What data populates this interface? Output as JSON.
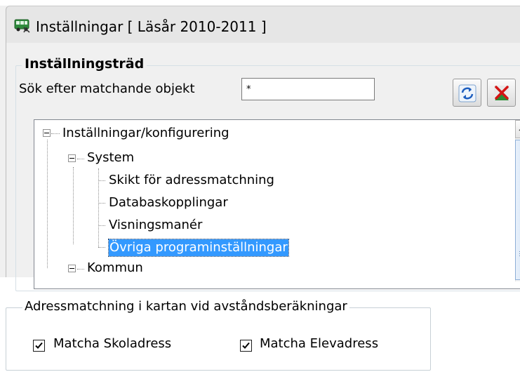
{
  "window": {
    "title": "Inställningar  [ Läsår 2010-2011 ]",
    "icon": "bus-icon"
  },
  "settings_tree_group": {
    "legend": "Inställningsträd",
    "search_label": "Sök efter matchande objekt",
    "search_value": "*",
    "refresh_icon": "refresh-icon",
    "clear_icon": "clear-filter-icon"
  },
  "tree": {
    "items": [
      {
        "label": "Inställningar/konfigurering",
        "level": 0,
        "expanded": true
      },
      {
        "label": "System",
        "level": 1,
        "expanded": true
      },
      {
        "label": "Skikt för adressmatchning",
        "level": 2
      },
      {
        "label": "Databaskopplingar",
        "level": 2
      },
      {
        "label": "Visningsmanér",
        "level": 2
      },
      {
        "label": "Övriga programinställningar",
        "level": 2,
        "selected": true
      },
      {
        "label": "Kommun",
        "level": 1,
        "expanded": true
      }
    ]
  },
  "address_matching_group": {
    "legend": "Adressmatchning i kartan vid avståndsberäkningar",
    "checkbox_school": {
      "label": "Matcha Skoladress",
      "checked": true
    },
    "checkbox_student": {
      "label": "Matcha Elevadress",
      "checked": true
    }
  },
  "colors": {
    "selection": "#3399ff",
    "window_bg": "#f0f0f0"
  }
}
